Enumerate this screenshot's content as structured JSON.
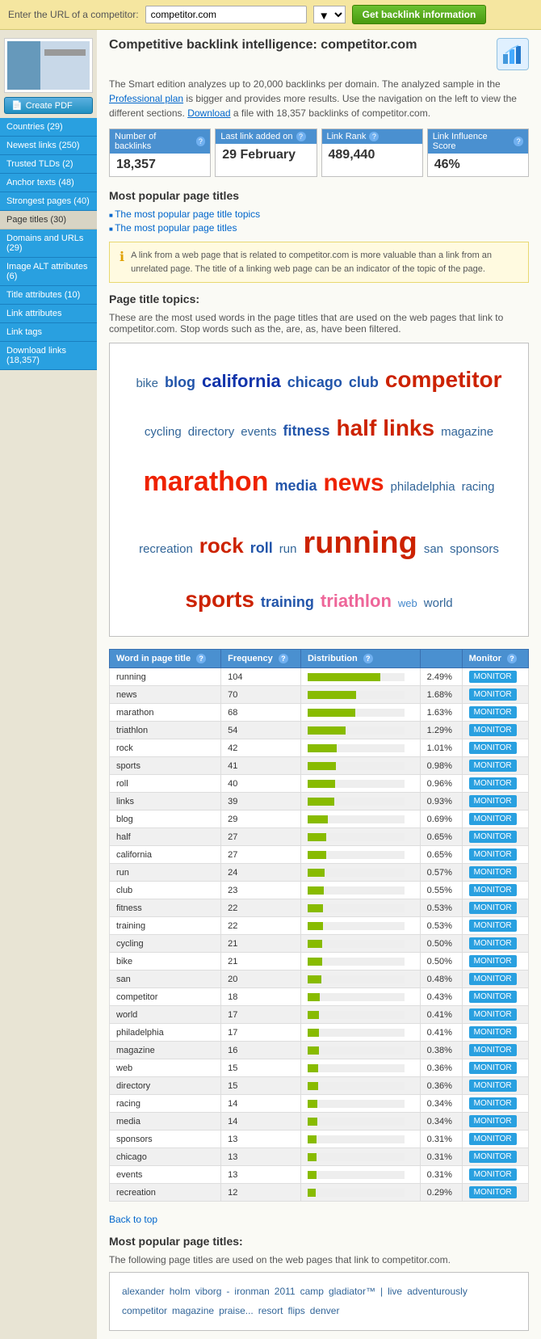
{
  "topbar": {
    "label": "Enter the URL of a competitor:",
    "url_value": "competitor.com",
    "button_label": "Get backlink information"
  },
  "header": {
    "title": "Competitive backlink intelligence: competitor.com",
    "description": "The Smart edition analyzes up to 20,000 backlinks per domain. The analyzed sample in the",
    "pro_plan_text": "Professional plan",
    "description2": "is bigger and provides more results. Use the navigation on the left to view the different sections.",
    "download_text": "Download",
    "description3": "a file with 18,357 backlinks of competitor.com."
  },
  "stats": {
    "backlinks": {
      "label": "Number of backlinks",
      "value": "18,357"
    },
    "last_link": {
      "label": "Last link added on",
      "value": "29 February"
    },
    "link_rank": {
      "label": "Link Rank",
      "value": "489,440"
    },
    "influence": {
      "label": "Link Influence Score",
      "value": "46%"
    }
  },
  "sidebar": {
    "nav_items": [
      {
        "label": "Countries (29)",
        "id": "countries"
      },
      {
        "label": "Newest links (250)",
        "id": "newest"
      },
      {
        "label": "Trusted TLDs (2)",
        "id": "trusted"
      },
      {
        "label": "Anchor texts (48)",
        "id": "anchor"
      },
      {
        "label": "Strongest pages (40)",
        "id": "strongest"
      },
      {
        "label": "Page titles (30)",
        "id": "page-titles"
      },
      {
        "label": "Domains and URLs (29)",
        "id": "domains"
      },
      {
        "label": "Image ALT attributes (6)",
        "id": "image-alt"
      },
      {
        "label": "Title attributes (10)",
        "id": "title-attr"
      },
      {
        "label": "Link attributes",
        "id": "link-attr"
      },
      {
        "label": "Link tags",
        "id": "link-tags"
      },
      {
        "label": "Download links (18,357)",
        "id": "download-links"
      }
    ]
  },
  "sections": {
    "popular_titles": {
      "title": "Most popular page titles",
      "link1": "The most popular page title topics",
      "link2": "The most popular page titles"
    },
    "page_title_topics": {
      "title": "Page title topics:",
      "description": "These are the most used words in the page titles that are used on the web pages that link to competitor.com. Stop words such as the, are, as, have been filtered."
    }
  },
  "info_box": {
    "text": "A link from a web page that is related to competitor.com is more valuable than a link from an unrelated page. The title of a linking web page can be an indicator of the topic of the page."
  },
  "word_cloud": [
    {
      "word": "bike",
      "size": "medium"
    },
    {
      "word": "blog",
      "size": "large"
    },
    {
      "word": "california",
      "size": "xlarge"
    },
    {
      "word": "chicago",
      "size": "large"
    },
    {
      "word": "club",
      "size": "large"
    },
    {
      "word": "competitor",
      "size": "xxlarge"
    },
    {
      "word": "cycling",
      "size": "medium"
    },
    {
      "word": "directory",
      "size": "medium"
    },
    {
      "word": "events",
      "size": "medium"
    },
    {
      "word": "fitness",
      "size": "large"
    },
    {
      "word": "half",
      "size": "xxlarge"
    },
    {
      "word": "links",
      "size": "xxlarge"
    },
    {
      "word": "magazine",
      "size": "medium"
    },
    {
      "word": "marathon",
      "size": "marathon"
    },
    {
      "word": "media",
      "size": "large"
    },
    {
      "word": "news",
      "size": "news"
    },
    {
      "word": "philadelphia",
      "size": "medium"
    },
    {
      "word": "racing",
      "size": "medium"
    },
    {
      "word": "recreation",
      "size": "medium"
    },
    {
      "word": "rock",
      "size": "rock"
    },
    {
      "word": "roll",
      "size": "large"
    },
    {
      "word": "run",
      "size": "medium"
    },
    {
      "word": "running",
      "size": "running"
    },
    {
      "word": "san",
      "size": "medium"
    },
    {
      "word": "sponsors",
      "size": "medium"
    },
    {
      "word": "sports",
      "size": "xxlarge"
    },
    {
      "word": "training",
      "size": "large"
    },
    {
      "word": "triathlon",
      "size": "triathlon"
    },
    {
      "word": "web",
      "size": "small"
    },
    {
      "word": "world",
      "size": "medium"
    }
  ],
  "table": {
    "columns": [
      "Word in page title",
      "Frequency",
      "Distribution",
      "",
      "Monitor"
    ],
    "rows": [
      {
        "word": "running",
        "freq": 104,
        "bar": 100,
        "dist": "2.49%"
      },
      {
        "word": "news",
        "freq": 70,
        "bar": 67,
        "dist": "1.68%"
      },
      {
        "word": "marathon",
        "freq": 68,
        "bar": 65,
        "dist": "1.63%"
      },
      {
        "word": "triathlon",
        "freq": 54,
        "bar": 52,
        "dist": "1.29%"
      },
      {
        "word": "rock",
        "freq": 42,
        "bar": 40,
        "dist": "1.01%"
      },
      {
        "word": "sports",
        "freq": 41,
        "bar": 39,
        "dist": "0.98%"
      },
      {
        "word": "roll",
        "freq": 40,
        "bar": 38,
        "dist": "0.96%"
      },
      {
        "word": "links",
        "freq": 39,
        "bar": 37,
        "dist": "0.93%"
      },
      {
        "word": "blog",
        "freq": 29,
        "bar": 28,
        "dist": "0.69%"
      },
      {
        "word": "half",
        "freq": 27,
        "bar": 26,
        "dist": "0.65%"
      },
      {
        "word": "california",
        "freq": 27,
        "bar": 26,
        "dist": "0.65%"
      },
      {
        "word": "run",
        "freq": 24,
        "bar": 23,
        "dist": "0.57%"
      },
      {
        "word": "club",
        "freq": 23,
        "bar": 22,
        "dist": "0.55%"
      },
      {
        "word": "fitness",
        "freq": 22,
        "bar": 21,
        "dist": "0.53%"
      },
      {
        "word": "training",
        "freq": 22,
        "bar": 21,
        "dist": "0.53%"
      },
      {
        "word": "cycling",
        "freq": 21,
        "bar": 20,
        "dist": "0.50%"
      },
      {
        "word": "bike",
        "freq": 21,
        "bar": 20,
        "dist": "0.50%"
      },
      {
        "word": "san",
        "freq": 20,
        "bar": 19,
        "dist": "0.48%"
      },
      {
        "word": "competitor",
        "freq": 18,
        "bar": 17,
        "dist": "0.43%"
      },
      {
        "word": "world",
        "freq": 17,
        "bar": 16,
        "dist": "0.41%"
      },
      {
        "word": "philadelphia",
        "freq": 17,
        "bar": 16,
        "dist": "0.41%"
      },
      {
        "word": "magazine",
        "freq": 16,
        "bar": 15,
        "dist": "0.38%"
      },
      {
        "word": "web",
        "freq": 15,
        "bar": 14,
        "dist": "0.36%"
      },
      {
        "word": "directory",
        "freq": 15,
        "bar": 14,
        "dist": "0.36%"
      },
      {
        "word": "racing",
        "freq": 14,
        "bar": 13,
        "dist": "0.34%"
      },
      {
        "word": "media",
        "freq": 14,
        "bar": 13,
        "dist": "0.34%"
      },
      {
        "word": "sponsors",
        "freq": 13,
        "bar": 12,
        "dist": "0.31%"
      },
      {
        "word": "chicago",
        "freq": 13,
        "bar": 12,
        "dist": "0.31%"
      },
      {
        "word": "events",
        "freq": 13,
        "bar": 12,
        "dist": "0.31%"
      },
      {
        "word": "recreation",
        "freq": 12,
        "bar": 11,
        "dist": "0.29%"
      }
    ],
    "monitor_label": "MONITOR"
  },
  "back_to_top": "Back to top",
  "popular_titles_section": {
    "title": "Most popular page titles:",
    "description": "The following page titles are used on the web pages that link to competitor.com.",
    "words": [
      "alexander",
      "holm",
      "viborg",
      "-",
      "ironman",
      "2011",
      "camp",
      "gladiator™",
      "|",
      "live",
      "adventurously",
      "competitor",
      "magazine",
      "praise...",
      "resort",
      "flips",
      "denver"
    ]
  }
}
